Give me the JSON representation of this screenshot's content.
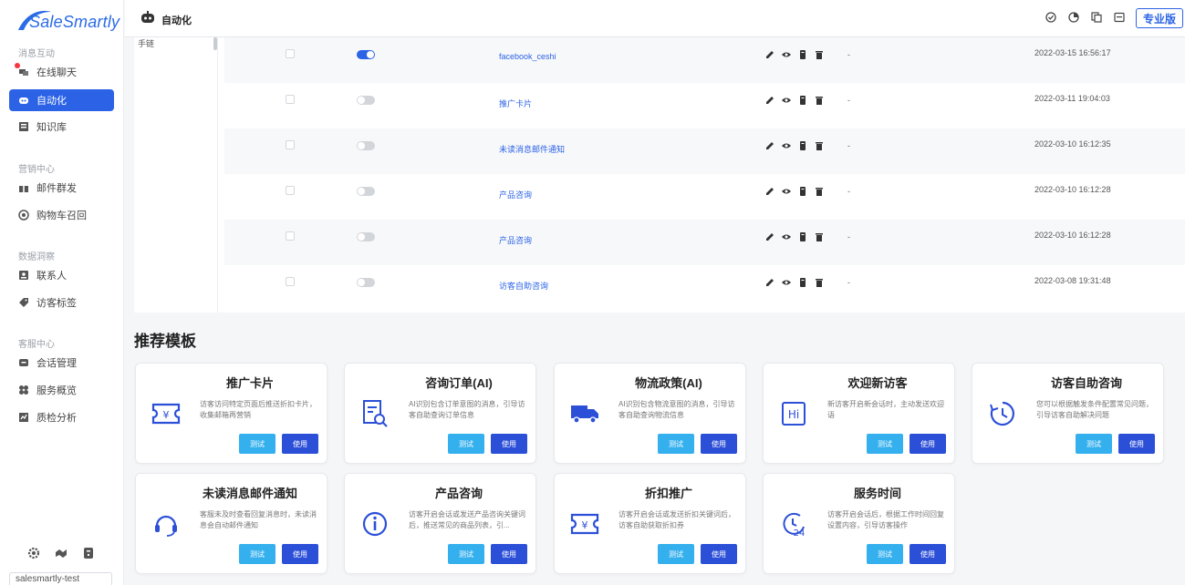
{
  "brand": {
    "logo_text": "SaleSmartly",
    "brand_color": "#2c63e6"
  },
  "sidebar": {
    "sections": [
      {
        "title": "消息互动"
      },
      {
        "title": "营销中心"
      },
      {
        "title": "数据洞察"
      },
      {
        "title": "客服中心"
      }
    ],
    "items": [
      {
        "label": "在线聊天",
        "icon": "chat-icon"
      },
      {
        "label": "自动化",
        "icon": "robot-icon",
        "active": true
      },
      {
        "label": "知识库",
        "icon": "book-icon"
      },
      {
        "label": "邮件群发",
        "icon": "gift-icon"
      },
      {
        "label": "购物车召回",
        "icon": "cart-recall-icon"
      },
      {
        "label": "联系人",
        "icon": "contact-icon"
      },
      {
        "label": "访客标签",
        "icon": "tag-icon"
      },
      {
        "label": "会话管理",
        "icon": "session-icon"
      },
      {
        "label": "服务概览",
        "icon": "overview-icon"
      },
      {
        "label": "质检分析",
        "icon": "quality-icon"
      }
    ],
    "user": "salesmartly-test"
  },
  "header": {
    "title": "自动化",
    "pro_label": "专业版"
  },
  "table": {
    "left_panel_text": "手链",
    "rows": [
      {
        "enabled": true,
        "name": "facebook_ceshi",
        "extra": "-",
        "date": "2022-03-15 16:56:17"
      },
      {
        "enabled": false,
        "name": "推广卡片",
        "extra": "-",
        "date": "2022-03-11 19:04:03"
      },
      {
        "enabled": false,
        "name": "未读消息邮件通知",
        "extra": "-",
        "date": "2022-03-10 16:12:35"
      },
      {
        "enabled": false,
        "name": "产品咨询",
        "extra": "-",
        "date": "2022-03-10 16:12:28"
      },
      {
        "enabled": false,
        "name": "产品咨询",
        "extra": "-",
        "date": "2022-03-10 16:12:28"
      },
      {
        "enabled": false,
        "name": "访客自助咨询",
        "extra": "-",
        "date": "2022-03-08 19:31:48"
      }
    ]
  },
  "templates": {
    "title": "推荐模板",
    "test_label": "测试",
    "use_label": "使用",
    "cards": [
      {
        "title": "推广卡片",
        "desc": "访客访问特定页面后推送折扣卡片，收集邮箱再营销",
        "icon": "coupon-icon"
      },
      {
        "title": "咨询订单(AI)",
        "desc": "AI识别包含订单意图的消息，引导访客自助查询订单信息",
        "icon": "order-search-icon"
      },
      {
        "title": "物流政策(AI)",
        "desc": "AI识别包含物流意图的消息，引导访客自助查询物流信息",
        "icon": "truck-icon"
      },
      {
        "title": "欢迎新访客",
        "desc": "新访客开启新会话时，主动发送欢迎语",
        "icon": "hi-icon"
      },
      {
        "title": "访客自助咨询",
        "desc": "您可以根据触发条件配置常见问题，引导访客自助解决问题",
        "icon": "clock-refresh-icon"
      },
      {
        "title": "未读消息邮件通知",
        "desc": "客服未及时查看回复消息时，未读消息会自动邮件通知",
        "icon": "headset-icon"
      },
      {
        "title": "产品咨询",
        "desc": "访客开启会话或发送产品咨询关键词后，推送常见的商品列表，引...",
        "icon": "info-icon"
      },
      {
        "title": "折扣推广",
        "desc": "访客开启会话或发送折扣关键词后，访客自助获取折扣券",
        "icon": "discount-icon"
      },
      {
        "title": "服务时间",
        "desc": "访客开启会话后，根据工作时间回复设置内容，引导访客操作",
        "icon": "clock-24-icon"
      }
    ]
  }
}
